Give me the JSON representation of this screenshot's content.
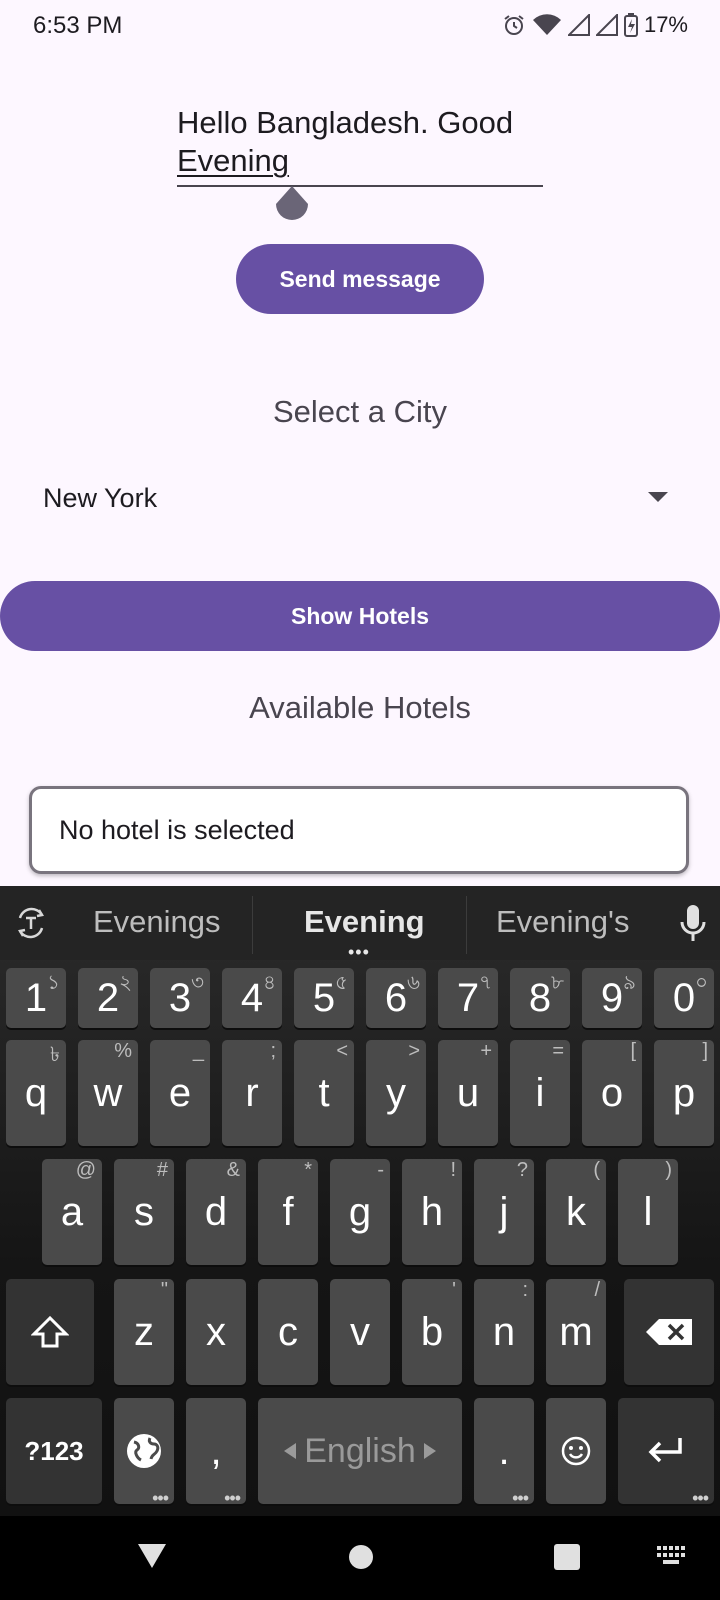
{
  "status_bar": {
    "time": "6:53 PM",
    "battery": "17%"
  },
  "message": {
    "line1": "Hello Bangladesh. Good",
    "line2": "Evening"
  },
  "buttons": {
    "send": "Send message",
    "show_hotels": "Show Hotels"
  },
  "city": {
    "title": "Select a City",
    "selected": "New York"
  },
  "hotels": {
    "title": "Available Hotels",
    "selection_text": "No hotel is selected"
  },
  "keyboard": {
    "suggestions": [
      "Evenings",
      "Evening",
      "Evening's"
    ],
    "row_numbers": [
      {
        "k": "1",
        "h": "১"
      },
      {
        "k": "2",
        "h": "২"
      },
      {
        "k": "3",
        "h": "৩"
      },
      {
        "k": "4",
        "h": "৪"
      },
      {
        "k": "5",
        "h": "৫"
      },
      {
        "k": "6",
        "h": "৬"
      },
      {
        "k": "7",
        "h": "৭"
      },
      {
        "k": "8",
        "h": "৮"
      },
      {
        "k": "9",
        "h": "৯"
      },
      {
        "k": "0",
        "h": "০"
      }
    ],
    "row_q": [
      {
        "k": "q",
        "h": "৳"
      },
      {
        "k": "w",
        "h": "%"
      },
      {
        "k": "e",
        "h": "_"
      },
      {
        "k": "r",
        "h": ";"
      },
      {
        "k": "t",
        "h": "<"
      },
      {
        "k": "y",
        "h": ">"
      },
      {
        "k": "u",
        "h": "+"
      },
      {
        "k": "i",
        "h": "="
      },
      {
        "k": "o",
        "h": "["
      },
      {
        "k": "p",
        "h": "]"
      }
    ],
    "row_a": [
      {
        "k": "a",
        "h": "@"
      },
      {
        "k": "s",
        "h": "#"
      },
      {
        "k": "d",
        "h": "&"
      },
      {
        "k": "f",
        "h": "*"
      },
      {
        "k": "g",
        "h": "-"
      },
      {
        "k": "h",
        "h": "!"
      },
      {
        "k": "j",
        "h": "?"
      },
      {
        "k": "k",
        "h": "("
      },
      {
        "k": "l",
        "h": ")"
      }
    ],
    "row_z": [
      {
        "k": "z",
        "h": "\""
      },
      {
        "k": "x",
        "h": ""
      },
      {
        "k": "c",
        "h": ""
      },
      {
        "k": "v",
        "h": ""
      },
      {
        "k": "b",
        "h": "'"
      },
      {
        "k": "n",
        "h": ":"
      },
      {
        "k": "m",
        "h": "/"
      }
    ],
    "symbols_key": "?123",
    "comma": ",",
    "period": ".",
    "space_label": "English"
  }
}
